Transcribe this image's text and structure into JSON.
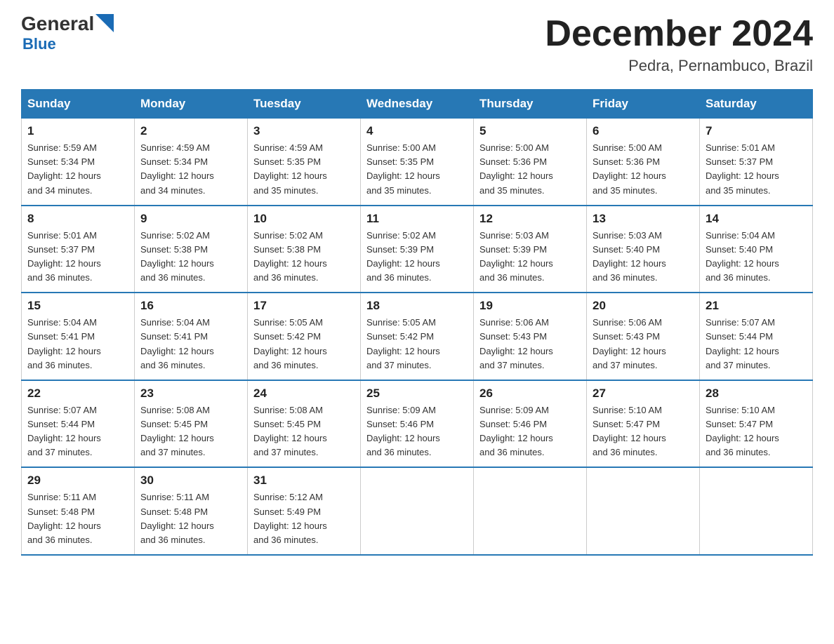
{
  "logo": {
    "text_general": "General",
    "text_blue": "Blue",
    "sub": "Blue"
  },
  "title": {
    "month_year": "December 2024",
    "location": "Pedra, Pernambuco, Brazil"
  },
  "headers": [
    "Sunday",
    "Monday",
    "Tuesday",
    "Wednesday",
    "Thursday",
    "Friday",
    "Saturday"
  ],
  "weeks": [
    [
      {
        "day": "1",
        "sunrise": "5:59 AM",
        "sunset": "5:34 PM",
        "daylight": "12 hours and 34 minutes."
      },
      {
        "day": "2",
        "sunrise": "4:59 AM",
        "sunset": "5:34 PM",
        "daylight": "12 hours and 34 minutes."
      },
      {
        "day": "3",
        "sunrise": "4:59 AM",
        "sunset": "5:35 PM",
        "daylight": "12 hours and 35 minutes."
      },
      {
        "day": "4",
        "sunrise": "5:00 AM",
        "sunset": "5:35 PM",
        "daylight": "12 hours and 35 minutes."
      },
      {
        "day": "5",
        "sunrise": "5:00 AM",
        "sunset": "5:36 PM",
        "daylight": "12 hours and 35 minutes."
      },
      {
        "day": "6",
        "sunrise": "5:00 AM",
        "sunset": "5:36 PM",
        "daylight": "12 hours and 35 minutes."
      },
      {
        "day": "7",
        "sunrise": "5:01 AM",
        "sunset": "5:37 PM",
        "daylight": "12 hours and 35 minutes."
      }
    ],
    [
      {
        "day": "8",
        "sunrise": "5:01 AM",
        "sunset": "5:37 PM",
        "daylight": "12 hours and 36 minutes."
      },
      {
        "day": "9",
        "sunrise": "5:02 AM",
        "sunset": "5:38 PM",
        "daylight": "12 hours and 36 minutes."
      },
      {
        "day": "10",
        "sunrise": "5:02 AM",
        "sunset": "5:38 PM",
        "daylight": "12 hours and 36 minutes."
      },
      {
        "day": "11",
        "sunrise": "5:02 AM",
        "sunset": "5:39 PM",
        "daylight": "12 hours and 36 minutes."
      },
      {
        "day": "12",
        "sunrise": "5:03 AM",
        "sunset": "5:39 PM",
        "daylight": "12 hours and 36 minutes."
      },
      {
        "day": "13",
        "sunrise": "5:03 AM",
        "sunset": "5:40 PM",
        "daylight": "12 hours and 36 minutes."
      },
      {
        "day": "14",
        "sunrise": "5:04 AM",
        "sunset": "5:40 PM",
        "daylight": "12 hours and 36 minutes."
      }
    ],
    [
      {
        "day": "15",
        "sunrise": "5:04 AM",
        "sunset": "5:41 PM",
        "daylight": "12 hours and 36 minutes."
      },
      {
        "day": "16",
        "sunrise": "5:04 AM",
        "sunset": "5:41 PM",
        "daylight": "12 hours and 36 minutes."
      },
      {
        "day": "17",
        "sunrise": "5:05 AM",
        "sunset": "5:42 PM",
        "daylight": "12 hours and 36 minutes."
      },
      {
        "day": "18",
        "sunrise": "5:05 AM",
        "sunset": "5:42 PM",
        "daylight": "12 hours and 37 minutes."
      },
      {
        "day": "19",
        "sunrise": "5:06 AM",
        "sunset": "5:43 PM",
        "daylight": "12 hours and 37 minutes."
      },
      {
        "day": "20",
        "sunrise": "5:06 AM",
        "sunset": "5:43 PM",
        "daylight": "12 hours and 37 minutes."
      },
      {
        "day": "21",
        "sunrise": "5:07 AM",
        "sunset": "5:44 PM",
        "daylight": "12 hours and 37 minutes."
      }
    ],
    [
      {
        "day": "22",
        "sunrise": "5:07 AM",
        "sunset": "5:44 PM",
        "daylight": "12 hours and 37 minutes."
      },
      {
        "day": "23",
        "sunrise": "5:08 AM",
        "sunset": "5:45 PM",
        "daylight": "12 hours and 37 minutes."
      },
      {
        "day": "24",
        "sunrise": "5:08 AM",
        "sunset": "5:45 PM",
        "daylight": "12 hours and 37 minutes."
      },
      {
        "day": "25",
        "sunrise": "5:09 AM",
        "sunset": "5:46 PM",
        "daylight": "12 hours and 36 minutes."
      },
      {
        "day": "26",
        "sunrise": "5:09 AM",
        "sunset": "5:46 PM",
        "daylight": "12 hours and 36 minutes."
      },
      {
        "day": "27",
        "sunrise": "5:10 AM",
        "sunset": "5:47 PM",
        "daylight": "12 hours and 36 minutes."
      },
      {
        "day": "28",
        "sunrise": "5:10 AM",
        "sunset": "5:47 PM",
        "daylight": "12 hours and 36 minutes."
      }
    ],
    [
      {
        "day": "29",
        "sunrise": "5:11 AM",
        "sunset": "5:48 PM",
        "daylight": "12 hours and 36 minutes."
      },
      {
        "day": "30",
        "sunrise": "5:11 AM",
        "sunset": "5:48 PM",
        "daylight": "12 hours and 36 minutes."
      },
      {
        "day": "31",
        "sunrise": "5:12 AM",
        "sunset": "5:49 PM",
        "daylight": "12 hours and 36 minutes."
      },
      null,
      null,
      null,
      null
    ]
  ],
  "labels": {
    "sunrise": "Sunrise:",
    "sunset": "Sunset:",
    "daylight": "Daylight:"
  }
}
